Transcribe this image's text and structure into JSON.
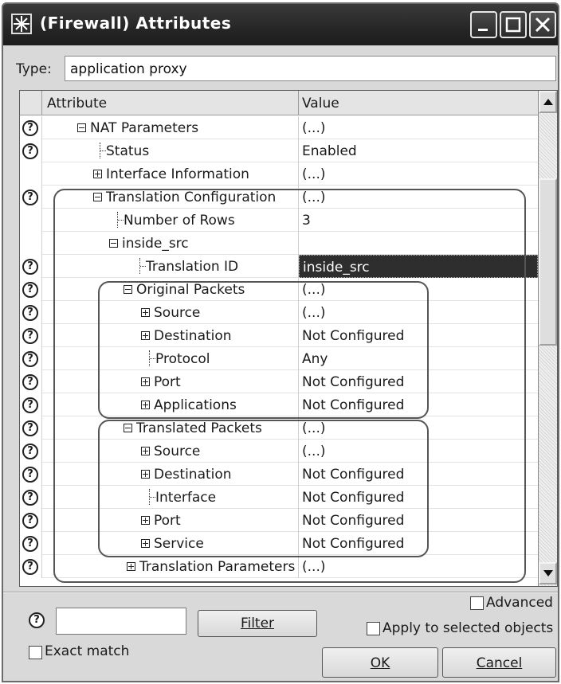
{
  "window": {
    "title": "(Firewall) Attributes"
  },
  "type": {
    "label": "Type:",
    "value": "application proxy"
  },
  "table": {
    "headers": {
      "attribute": "Attribute",
      "value": "Value"
    },
    "rows": [
      {
        "label": "NAT Parameters",
        "value": "(...)",
        "help": true,
        "expander": "minus"
      },
      {
        "label": "Status",
        "value": "Enabled",
        "help": true,
        "expander": "leaf"
      },
      {
        "label": "Interface Information",
        "value": "(...)",
        "help": false,
        "expander": "plus"
      },
      {
        "label": "Translation Configuration",
        "value": "(...)",
        "help": true,
        "expander": "minus"
      },
      {
        "label": "Number of Rows",
        "value": "3",
        "help": false,
        "expander": "leaf"
      },
      {
        "label": "inside_src",
        "value": "",
        "help": false,
        "expander": "minus"
      },
      {
        "label": "Translation ID",
        "value": "inside_src",
        "help": true,
        "expander": "leaf",
        "selected": true
      },
      {
        "label": "Original Packets",
        "value": "(...)",
        "help": true,
        "expander": "minus"
      },
      {
        "label": "Source",
        "value": "(...)",
        "help": true,
        "expander": "plus"
      },
      {
        "label": "Destination",
        "value": "Not Configured",
        "help": true,
        "expander": "plus"
      },
      {
        "label": "Protocol",
        "value": "Any",
        "help": true,
        "expander": "leaf"
      },
      {
        "label": "Port",
        "value": "Not Configured",
        "help": true,
        "expander": "plus"
      },
      {
        "label": "Applications",
        "value": "Not Configured",
        "help": true,
        "expander": "plus"
      },
      {
        "label": "Translated Packets",
        "value": "(...)",
        "help": true,
        "expander": "minus"
      },
      {
        "label": "Source",
        "value": "(...)",
        "help": true,
        "expander": "plus"
      },
      {
        "label": "Destination",
        "value": "Not Configured",
        "help": true,
        "expander": "plus"
      },
      {
        "label": "Interface",
        "value": "Not Configured",
        "help": true,
        "expander": "leaf"
      },
      {
        "label": "Port",
        "value": "Not Configured",
        "help": true,
        "expander": "plus"
      },
      {
        "label": "Service",
        "value": "Not Configured",
        "help": true,
        "expander": "plus"
      },
      {
        "label": "Translation Parameters",
        "value": "(...)",
        "help": true,
        "expander": "plus"
      }
    ]
  },
  "footer": {
    "help_glyph": "?",
    "filter_value": "",
    "filter_button": "Filter",
    "exact_match_label": "Exact match",
    "advanced_label": "Advanced",
    "apply_label": "Apply to selected objects",
    "ok_label": "OK",
    "cancel_label": "Cancel"
  }
}
